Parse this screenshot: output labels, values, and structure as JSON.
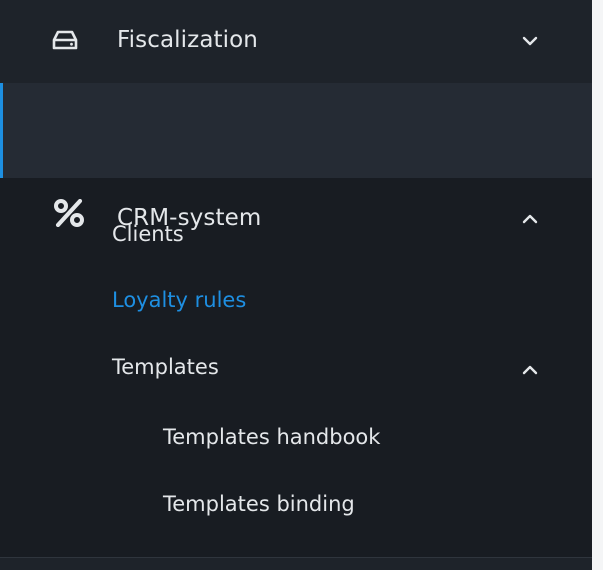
{
  "colors": {
    "background": "#181c22",
    "section_bg": "#1e232a",
    "active_bg": "#252b34",
    "accent": "#1d8fe1",
    "text": "#e4e7ea"
  },
  "menu": {
    "fiscalization": {
      "label": "Fiscalization",
      "icon": "hard-drive-icon",
      "expanded": false
    },
    "crm": {
      "label": "CRM-system",
      "icon": "percent-icon",
      "expanded": true,
      "active": true,
      "items": [
        {
          "label": "Clients",
          "active": false
        },
        {
          "label": "Loyalty rules",
          "active": true
        },
        {
          "label": "Templates",
          "expanded": true,
          "items": [
            {
              "label": "Templates handbook"
            },
            {
              "label": "Templates binding"
            }
          ]
        }
      ]
    }
  }
}
